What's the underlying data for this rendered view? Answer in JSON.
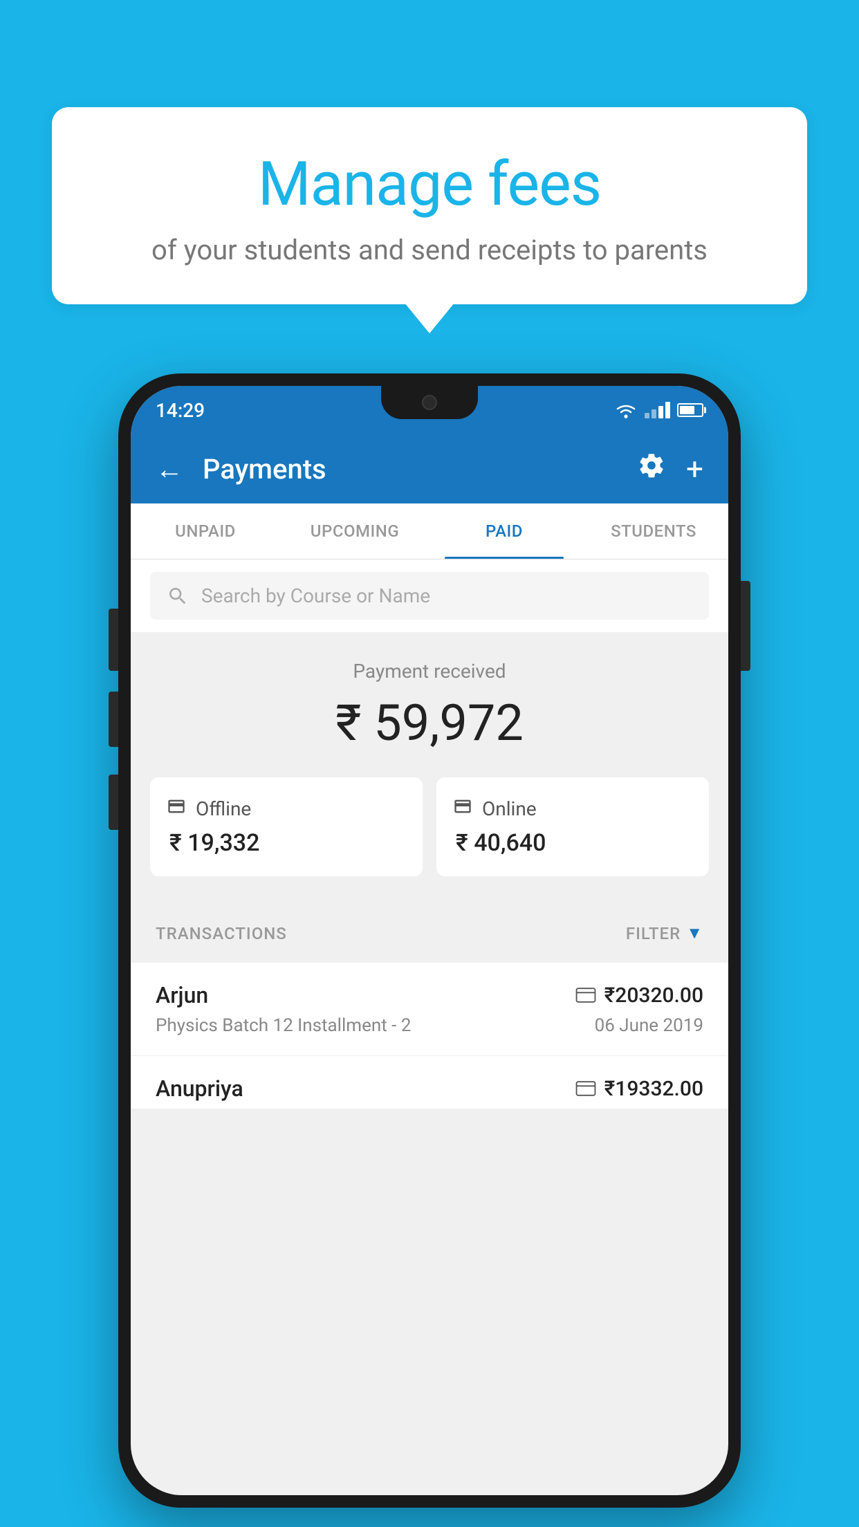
{
  "background_color": "#1ab4e8",
  "speech_bubble": {
    "title": "Manage fees",
    "subtitle": "of your students and send receipts to parents"
  },
  "status_bar": {
    "time": "14:29"
  },
  "header": {
    "title": "Payments",
    "back_label": "←",
    "gear_label": "⚙",
    "plus_label": "+"
  },
  "tabs": [
    {
      "label": "UNPAID",
      "active": false
    },
    {
      "label": "UPCOMING",
      "active": false
    },
    {
      "label": "PAID",
      "active": true
    },
    {
      "label": "STUDENTS",
      "active": false
    }
  ],
  "search": {
    "placeholder": "Search by Course or Name"
  },
  "payment_summary": {
    "label": "Payment received",
    "amount": "₹ 59,972",
    "offline_label": "Offline",
    "offline_amount": "₹ 19,332",
    "online_label": "Online",
    "online_amount": "₹ 40,640"
  },
  "transactions": {
    "header_label": "TRANSACTIONS",
    "filter_label": "FILTER",
    "rows": [
      {
        "name": "Arjun",
        "amount": "₹20320.00",
        "course": "Physics Batch 12 Installment - 2",
        "date": "06 June 2019",
        "payment_type": "online"
      },
      {
        "name": "Anupriya",
        "amount": "₹19332.00",
        "course": "",
        "date": "",
        "payment_type": "offline"
      }
    ]
  }
}
